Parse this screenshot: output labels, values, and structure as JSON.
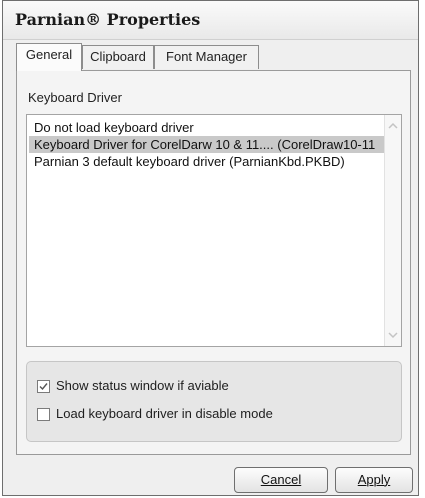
{
  "window": {
    "title": "Parnian® Properties"
  },
  "tabs": [
    {
      "label": "General",
      "active": true
    },
    {
      "label": "Clipboard",
      "active": false
    },
    {
      "label": "Font Manager",
      "active": false
    }
  ],
  "general": {
    "group_label": "Keyboard Driver",
    "drivers": [
      {
        "label": "Do not load keyboard driver",
        "selected": false
      },
      {
        "label": "Keyboard Driver for CorelDarw 10 & 11.... (CorelDraw10-11",
        "selected": true
      },
      {
        "label": "Parnian 3 default keyboard driver (ParnianKbd.PKBD)",
        "selected": false
      }
    ],
    "options": [
      {
        "label": "Show status window if aviable",
        "checked": true
      },
      {
        "label": "Load keyboard driver in disable mode",
        "checked": false
      }
    ]
  },
  "buttons": {
    "cancel": "Cancel",
    "apply": "Apply"
  },
  "icons": {
    "scroll_up": "chevron-up-icon",
    "scroll_down": "chevron-down-icon",
    "check": "checkmark-icon"
  },
  "colors": {
    "selection": "#c9c9c9",
    "window_bg": "#efefef"
  }
}
